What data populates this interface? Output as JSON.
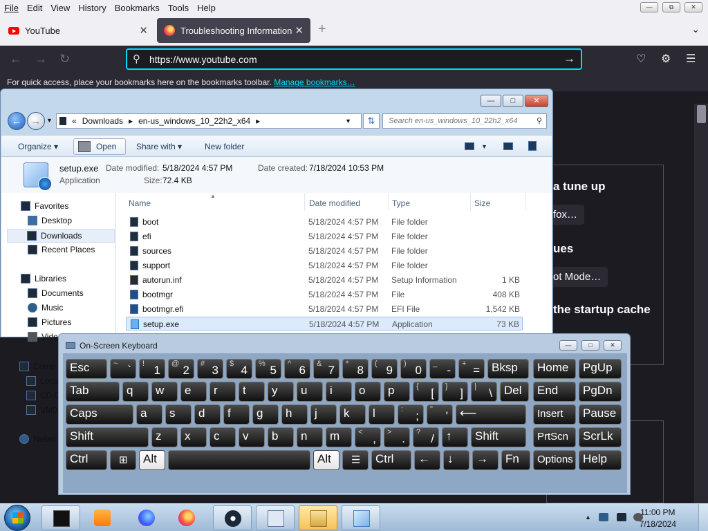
{
  "firefox": {
    "menu": [
      "File",
      "Edit",
      "View",
      "History",
      "Bookmarks",
      "Tools",
      "Help"
    ],
    "tabs": [
      {
        "label": "YouTube"
      },
      {
        "label": "Troubleshooting Information"
      }
    ],
    "url": "https://www.youtube.com",
    "bookmarks_hint": "For quick access, place your bookmarks here on the bookmarks toolbar.",
    "bookmarks_link": "Manage bookmarks…"
  },
  "page": {
    "heading1": "a tune up",
    "button1": "fox…",
    "heading2": "ues",
    "button2": "ot Mode…",
    "heading3": "the startup cache"
  },
  "explorer": {
    "breadcrumb_prefix": "«",
    "breadcrumb": [
      "Downloads",
      "en-us_windows_10_22h2_x64"
    ],
    "search_placeholder": "Search en-us_windows_10_22h2_x64",
    "toolbar": {
      "organize": "Organize",
      "open": "Open",
      "share_with": "Share with",
      "new_folder": "New folder"
    },
    "details": {
      "name": "setup.exe",
      "type": "Application",
      "date_modified_label": "Date modified:",
      "date_modified": "5/18/2024 4:57 PM",
      "date_created_label": "Date created:",
      "date_created": "7/18/2024 10:53 PM",
      "size_label": "Size:",
      "size": "72.4 KB"
    },
    "nav": {
      "favorites": "Favorites",
      "desktop": "Desktop",
      "downloads": "Downloads",
      "recent": "Recent Places",
      "libraries": "Libraries",
      "documents": "Documents",
      "music": "Music",
      "pictures": "Pictures",
      "videos": "Vide",
      "computer": "Comp",
      "local": "Loca",
      "cd": "CD D",
      "vm": "VM0",
      "network": "Netwo"
    },
    "columns": {
      "name": "Name",
      "date": "Date modified",
      "type": "Type",
      "size": "Size"
    },
    "files": [
      {
        "name": "boot",
        "date": "5/18/2024 4:57 PM",
        "type": "File folder",
        "size": ""
      },
      {
        "name": "efi",
        "date": "5/18/2024 4:57 PM",
        "type": "File folder",
        "size": ""
      },
      {
        "name": "sources",
        "date": "5/18/2024 4:57 PM",
        "type": "File folder",
        "size": ""
      },
      {
        "name": "support",
        "date": "5/18/2024 4:57 PM",
        "type": "File folder",
        "size": ""
      },
      {
        "name": "autorun.inf",
        "date": "5/18/2024 4:57 PM",
        "type": "Setup Information",
        "size": "1 KB"
      },
      {
        "name": "bootmgr",
        "date": "5/18/2024 4:57 PM",
        "type": "File",
        "size": "408 KB"
      },
      {
        "name": "bootmgr.efi",
        "date": "5/18/2024 4:57 PM",
        "type": "EFI File",
        "size": "1,542 KB"
      },
      {
        "name": "setup.exe",
        "date": "5/18/2024 4:57 PM",
        "type": "Application",
        "size": "73 KB"
      }
    ]
  },
  "osk": {
    "title": "On-Screen Keyboard",
    "rows": [
      [
        {
          "t": "",
          "b": "Esc",
          "w": 60
        },
        {
          "t": "~",
          "b": "`",
          "w": 38
        },
        {
          "t": "!",
          "b": "1",
          "w": 38
        },
        {
          "t": "@",
          "b": "2",
          "w": 38
        },
        {
          "t": "#",
          "b": "3",
          "w": 38
        },
        {
          "t": "$",
          "b": "4",
          "w": 38
        },
        {
          "t": "%",
          "b": "5",
          "w": 38
        },
        {
          "t": "^",
          "b": "6",
          "w": 38
        },
        {
          "t": "&",
          "b": "7",
          "w": 38
        },
        {
          "t": "*",
          "b": "8",
          "w": 38
        },
        {
          "t": "(",
          "b": "9",
          "w": 38
        },
        {
          "t": ")",
          "b": "0",
          "w": 38
        },
        {
          "t": "_",
          "b": "-",
          "w": 38
        },
        {
          "t": "+",
          "b": "=",
          "w": 38
        },
        {
          "t": "",
          "b": "Bksp",
          "w": 60
        },
        {
          "t": "",
          "b": "Home",
          "w": 62,
          "gap": true
        },
        {
          "t": "",
          "b": "PgUp",
          "w": 62
        }
      ],
      [
        {
          "t": "",
          "b": "Tab",
          "w": 78
        },
        {
          "t": "",
          "b": "q",
          "w": 38
        },
        {
          "t": "",
          "b": "w",
          "w": 38
        },
        {
          "t": "",
          "b": "e",
          "w": 38
        },
        {
          "t": "",
          "b": "r",
          "w": 38
        },
        {
          "t": "",
          "b": "t",
          "w": 38
        },
        {
          "t": "",
          "b": "y",
          "w": 38
        },
        {
          "t": "",
          "b": "u",
          "w": 38
        },
        {
          "t": "",
          "b": "i",
          "w": 38
        },
        {
          "t": "",
          "b": "o",
          "w": 38
        },
        {
          "t": "",
          "b": "p",
          "w": 38
        },
        {
          "t": "{",
          "b": "[",
          "w": 38
        },
        {
          "t": "}",
          "b": "]",
          "w": 38
        },
        {
          "t": "|",
          "b": "\\",
          "w": 38
        },
        {
          "t": "",
          "b": "Del",
          "w": 42
        },
        {
          "t": "",
          "b": "End",
          "w": 62,
          "gap": true
        },
        {
          "t": "",
          "b": "PgDn",
          "w": 62
        }
      ],
      [
        {
          "t": "",
          "b": "Caps",
          "w": 98
        },
        {
          "t": "",
          "b": "a",
          "w": 38
        },
        {
          "t": "",
          "b": "s",
          "w": 38
        },
        {
          "t": "",
          "b": "d",
          "w": 38
        },
        {
          "t": "",
          "b": "f",
          "w": 38
        },
        {
          "t": "",
          "b": "g",
          "w": 38
        },
        {
          "t": "",
          "b": "h",
          "w": 38
        },
        {
          "t": "",
          "b": "j",
          "w": 38
        },
        {
          "t": "",
          "b": "k",
          "w": 38
        },
        {
          "t": "",
          "b": "l",
          "w": 38
        },
        {
          "t": ":",
          "b": ";",
          "w": 38
        },
        {
          "t": "\"",
          "b": "'",
          "w": 38
        },
        {
          "t": "",
          "b": "⟵",
          "w": 102
        },
        {
          "t": "",
          "b": "Insert",
          "w": 62,
          "gap": true
        },
        {
          "t": "",
          "b": "Pause",
          "w": 62
        }
      ],
      [
        {
          "t": "",
          "b": "Shift",
          "w": 120
        },
        {
          "t": "",
          "b": "z",
          "w": 38
        },
        {
          "t": "",
          "b": "x",
          "w": 38
        },
        {
          "t": "",
          "b": "c",
          "w": 38
        },
        {
          "t": "",
          "b": "v",
          "w": 38
        },
        {
          "t": "",
          "b": "b",
          "w": 38
        },
        {
          "t": "",
          "b": "n",
          "w": 38
        },
        {
          "t": "",
          "b": "m",
          "w": 38
        },
        {
          "t": "<",
          "b": ",",
          "w": 38
        },
        {
          "t": ">",
          "b": ".",
          "w": 38
        },
        {
          "t": "?",
          "b": "/",
          "w": 38
        },
        {
          "t": "",
          "b": "↑",
          "w": 38
        },
        {
          "t": "",
          "b": "Shift",
          "w": 80
        },
        {
          "t": "",
          "b": "PrtScn",
          "w": 62,
          "gap": true
        },
        {
          "t": "",
          "b": "ScrLk",
          "w": 62
        }
      ],
      [
        {
          "t": "",
          "b": "Ctrl",
          "w": 60
        },
        {
          "t": "",
          "b": "win-logo-icon",
          "w": 38,
          "icon": true
        },
        {
          "t": "",
          "b": "Alt",
          "w": 38,
          "light": true
        },
        {
          "t": "",
          "b": "",
          "w": 206
        },
        {
          "t": "",
          "b": "Alt",
          "w": 38,
          "light": true
        },
        {
          "t": "",
          "b": "menu-icon",
          "w": 38,
          "icon": true
        },
        {
          "t": "",
          "b": "Ctrl",
          "w": 58
        },
        {
          "t": "",
          "b": "←",
          "w": 38
        },
        {
          "t": "",
          "b": "↓",
          "w": 38
        },
        {
          "t": "",
          "b": "→",
          "w": 38
        },
        {
          "t": "",
          "b": "Fn",
          "w": 42
        },
        {
          "t": "",
          "b": "Options",
          "w": 62,
          "gap": true
        },
        {
          "t": "",
          "b": "Help",
          "w": 62
        }
      ]
    ]
  },
  "taskbar": {
    "time": "11:00 PM",
    "date": "7/18/2024"
  },
  "colors": {
    "firefox_dark": "#2b2a33",
    "url_focus": "#00ddff",
    "explorer_frame": "#c4d8ec",
    "selection": "#dcebfc"
  }
}
